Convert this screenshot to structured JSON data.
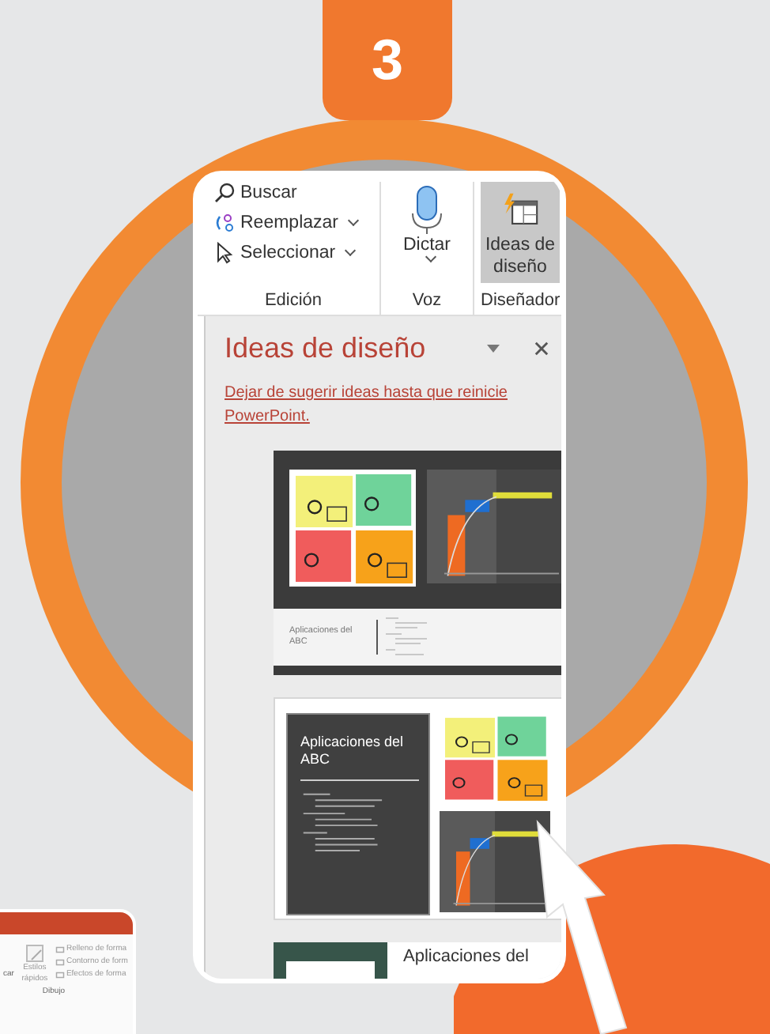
{
  "step_badge": "3",
  "ribbon": {
    "groups": [
      {
        "label": "Edición",
        "items": [
          {
            "kind": "search",
            "label": "Buscar",
            "dropdown": false,
            "selected": false
          },
          {
            "kind": "replace",
            "label": "Reemplazar",
            "dropdown": true,
            "selected": false
          },
          {
            "kind": "select",
            "label": "Seleccionar",
            "dropdown": true,
            "selected": false
          }
        ]
      },
      {
        "label": "Voz",
        "items": [
          {
            "kind": "mic",
            "label": "Dictar",
            "dropdown": true,
            "selected": false
          }
        ]
      },
      {
        "label": "Diseñador",
        "items": [
          {
            "kind": "designer",
            "label": "Ideas de diseño",
            "dropdown": false,
            "selected": true
          }
        ]
      }
    ]
  },
  "design_pane": {
    "title": "Ideas de diseño",
    "link": "Dejar de sugerir ideas hasta que reinicie PowerPoint.",
    "designs": [
      {
        "kind": "banner",
        "title": "Aplicaciones del ABC"
      },
      {
        "kind": "dark",
        "title": "Aplicaciones del ABC"
      },
      {
        "kind": "green",
        "title": "Aplicaciones del"
      }
    ]
  },
  "inset": {
    "button": "car",
    "styles": "Estilos rápidos",
    "items": [
      "Relleno de forma",
      "Contorno de form",
      "Efectos de forma"
    ],
    "group": "Dibujo"
  }
}
